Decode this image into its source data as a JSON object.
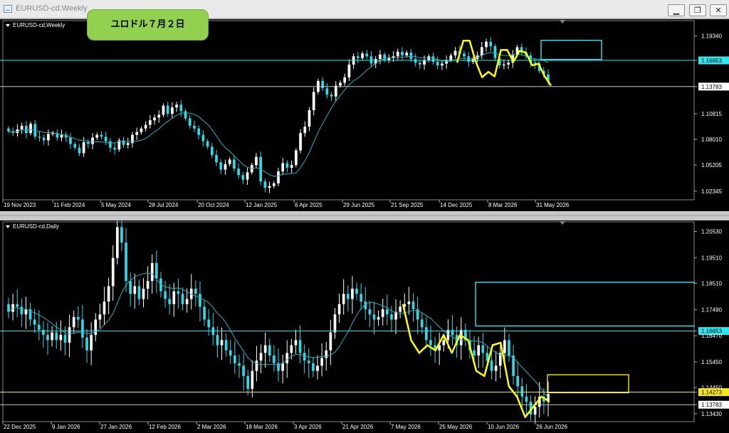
{
  "window": {
    "title": "EURUSD-cd,Weekly",
    "icons": [
      "chart-window-icon",
      "minimize-icon",
      "restore-icon",
      "close-icon"
    ]
  },
  "annotation_badge": {
    "text": "ユロドル７月２日",
    "color": "#92d050"
  },
  "colors": {
    "background": "#000000",
    "bull_candle": "#ffffff",
    "bear_candle": "#2ed9e8",
    "moving_average": "#21b3bf",
    "hline_cyan": "#2ee6ee",
    "hline_white": "#c8c8c8",
    "hline_yellow": "#f5e61e",
    "drawing_yellow": "#ffff00",
    "rect_cyan": "#2ee6ee",
    "rect_yellow": "#f5e61e",
    "current_price_box": "#3399ff"
  },
  "chart_data": [
    {
      "type": "candlestick",
      "symbol_label": "EURUSD-cd,Weekly",
      "y_axis_ticks": [
        "1.19340",
        "1.16653",
        "1.13783",
        "1.10815",
        "1.08010",
        "1.05205",
        "1.02345"
      ],
      "ylim": [
        1.0155,
        1.2085
      ],
      "x_axis_ticks": [
        "19 Nov 2023",
        "11 Feb 2024",
        "5 May 2024",
        "28 Jul 2024",
        "20 Oct 2024",
        "12 Jan 2025",
        "6 Apr 2025",
        "29 Jun 2025",
        "21 Sep 2025",
        "14 Dec 2025",
        "8 Mar 2026",
        "31 May 2026"
      ],
      "horizontal_lines": [
        {
          "value": 1.16653,
          "label": "1.16653",
          "style": "cyan-highlight"
        },
        {
          "value": 1.13783,
          "label": "1.13783",
          "style": "white"
        }
      ],
      "close_path": [
        1.089,
        1.087,
        1.091,
        1.095,
        1.087,
        1.097,
        1.083,
        1.082,
        1.079,
        1.086,
        1.087,
        1.082,
        1.085,
        1.082,
        1.075,
        1.071,
        1.065,
        1.077,
        1.075,
        1.082,
        1.085,
        1.083,
        1.078,
        1.071,
        1.069,
        1.079,
        1.074,
        1.076,
        1.085,
        1.088,
        1.092,
        1.096,
        1.101,
        1.104,
        1.107,
        1.117,
        1.108,
        1.115,
        1.118,
        1.111,
        1.103,
        1.095,
        1.092,
        1.085,
        1.078,
        1.072,
        1.063,
        1.055,
        1.047,
        1.053,
        1.058,
        1.048,
        1.041,
        1.036,
        1.044,
        1.052,
        1.061,
        1.034,
        1.027,
        1.029,
        1.032,
        1.045,
        1.054,
        1.049,
        1.052,
        1.068,
        1.087,
        1.094,
        1.112,
        1.132,
        1.144,
        1.136,
        1.129,
        1.127,
        1.139,
        1.142,
        1.148,
        1.162,
        1.171,
        1.169,
        1.174,
        1.171,
        1.163,
        1.168,
        1.173,
        1.167,
        1.169,
        1.171,
        1.176,
        1.172,
        1.175,
        1.168,
        1.164,
        1.162,
        1.167,
        1.171,
        1.165,
        1.161,
        1.163,
        1.167,
        1.172,
        1.177,
        1.174,
        1.171,
        1.165,
        1.168,
        1.172,
        1.181,
        1.187,
        1.182,
        1.169,
        1.161,
        1.162,
        1.164,
        1.173,
        1.181,
        1.175,
        1.172,
        1.164,
        1.163,
        1.155,
        1.151,
        1.143
      ],
      "moving_average_color": "#21b3bf",
      "rectangles": [
        {
          "from_label": "31 May 2026",
          "top": 1.1885,
          "bottom": 1.1675,
          "color": "#2ee6ee"
        }
      ],
      "freehand_yellow_path": [
        1.164,
        1.188,
        1.188,
        1.165,
        1.148,
        1.154,
        1.149,
        1.178,
        1.178,
        1.165,
        1.177,
        1.175,
        1.161,
        1.163,
        1.149,
        1.139
      ]
    },
    {
      "type": "candlestick",
      "symbol_label": "EURUSD-cd,Daily",
      "y_axis_ticks": [
        "1.20530",
        "1.19510",
        "1.18510",
        "1.17490",
        "1.16653",
        "1.16470",
        "1.15450",
        "1.14450",
        "1.14273",
        "1.13783",
        "1.13430"
      ],
      "ylim": [
        1.1318,
        1.2085
      ],
      "x_axis_ticks": [
        "22 Dec 2025",
        "9 Jan 2026",
        "27 Jan 2026",
        "12 Feb 2026",
        "2 Mar 2026",
        "18 Mar 2026",
        "3 Apr 2026",
        "21 Apr 2026",
        "7 May 2026",
        "25 May 2026",
        "10 Jun 2026",
        "26 Jun 2026"
      ],
      "horizontal_lines": [
        {
          "value": 1.16653,
          "label": "1.16653",
          "style": "cyan-highlight"
        },
        {
          "value": 1.14273,
          "label": "1.14273",
          "style": "yellow-highlight"
        },
        {
          "value": 1.13783,
          "label": "1.13783",
          "style": "white"
        }
      ],
      "close_path": [
        1.174,
        1.177,
        1.176,
        1.173,
        1.175,
        1.171,
        1.169,
        1.167,
        1.165,
        1.163,
        1.166,
        1.163,
        1.165,
        1.162,
        1.168,
        1.172,
        1.171,
        1.164,
        1.159,
        1.165,
        1.171,
        1.173,
        1.178,
        1.184,
        1.195,
        1.207,
        1.201,
        1.186,
        1.181,
        1.184,
        1.179,
        1.183,
        1.186,
        1.193,
        1.187,
        1.182,
        1.179,
        1.177,
        1.182,
        1.181,
        1.177,
        1.179,
        1.183,
        1.181,
        1.176,
        1.171,
        1.168,
        1.165,
        1.161,
        1.163,
        1.159,
        1.157,
        1.154,
        1.153,
        1.149,
        1.144,
        1.151,
        1.155,
        1.158,
        1.161,
        1.157,
        1.154,
        1.151,
        1.154,
        1.158,
        1.161,
        1.163,
        1.158,
        1.155,
        1.154,
        1.151,
        1.153,
        1.156,
        1.159,
        1.166,
        1.173,
        1.177,
        1.181,
        1.179,
        1.183,
        1.181,
        1.178,
        1.175,
        1.173,
        1.171,
        1.172,
        1.175,
        1.173,
        1.171,
        1.174,
        1.176,
        1.177,
        1.178,
        1.175,
        1.171,
        1.168,
        1.163,
        1.161,
        1.159,
        1.161,
        1.163,
        1.167,
        1.165,
        1.161,
        1.167,
        1.163,
        1.159,
        1.157,
        1.161,
        1.158,
        1.155,
        1.151,
        1.153,
        1.158,
        1.163,
        1.157,
        1.149,
        1.145,
        1.141,
        1.139,
        1.134,
        1.137,
        1.141,
        1.139,
        1.142
      ],
      "moving_average_color": "#21b3bf",
      "rectangles": [
        {
          "from_label": "25 May 2026",
          "top": 1.1855,
          "bottom": 1.1685,
          "color": "#2ee6ee"
        },
        {
          "from_label": "26 Jun 2026",
          "top": 1.1495,
          "bottom": 1.1425,
          "color": "#f5e61e"
        }
      ],
      "freehand_yellow_path": [
        1.177,
        1.163,
        1.158,
        1.161,
        1.159,
        1.165,
        1.158,
        1.165,
        1.163,
        1.151,
        1.149,
        1.161,
        1.162,
        1.145,
        1.141,
        1.133,
        1.137,
        1.141,
        1.139
      ]
    }
  ]
}
